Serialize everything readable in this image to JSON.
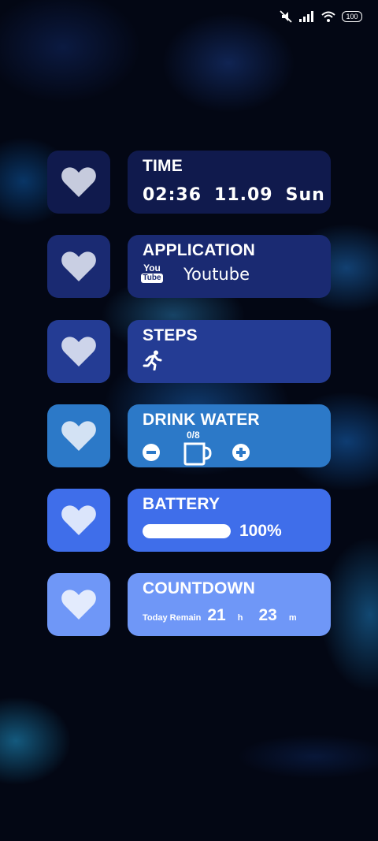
{
  "status_bar": {
    "icons": [
      "mute-icon",
      "signal-icon",
      "wifi-icon"
    ],
    "battery_level": "100"
  },
  "widgets": {
    "time": {
      "title": "TIME",
      "clock": "02:36",
      "date": "11.09",
      "weekday": "Sun"
    },
    "application": {
      "title": "APPLICATION",
      "logo_top": "You",
      "logo_bottom": "Tube",
      "app_name": "Youtube"
    },
    "steps": {
      "title": "STEPS",
      "icon": "running-person-icon"
    },
    "drink_water": {
      "title": "DRINK WATER",
      "count": "0/8",
      "icons": [
        "minus-icon",
        "cup-icon",
        "plus-icon"
      ]
    },
    "battery": {
      "title": "BATTERY",
      "percent_text": "100%",
      "level": 1.0
    },
    "countdown": {
      "title": "COUNTDOWN",
      "label": "Today Remain",
      "hours": "21",
      "hours_unit": "h",
      "minutes": "23",
      "minutes_unit": "m"
    }
  },
  "colors": {
    "row1": "#101a4d",
    "row2": "#1a2a72",
    "row3": "#243c94",
    "row4": "#2c79c8",
    "row5": "#3f6eea",
    "row6": "#6f97f7"
  }
}
